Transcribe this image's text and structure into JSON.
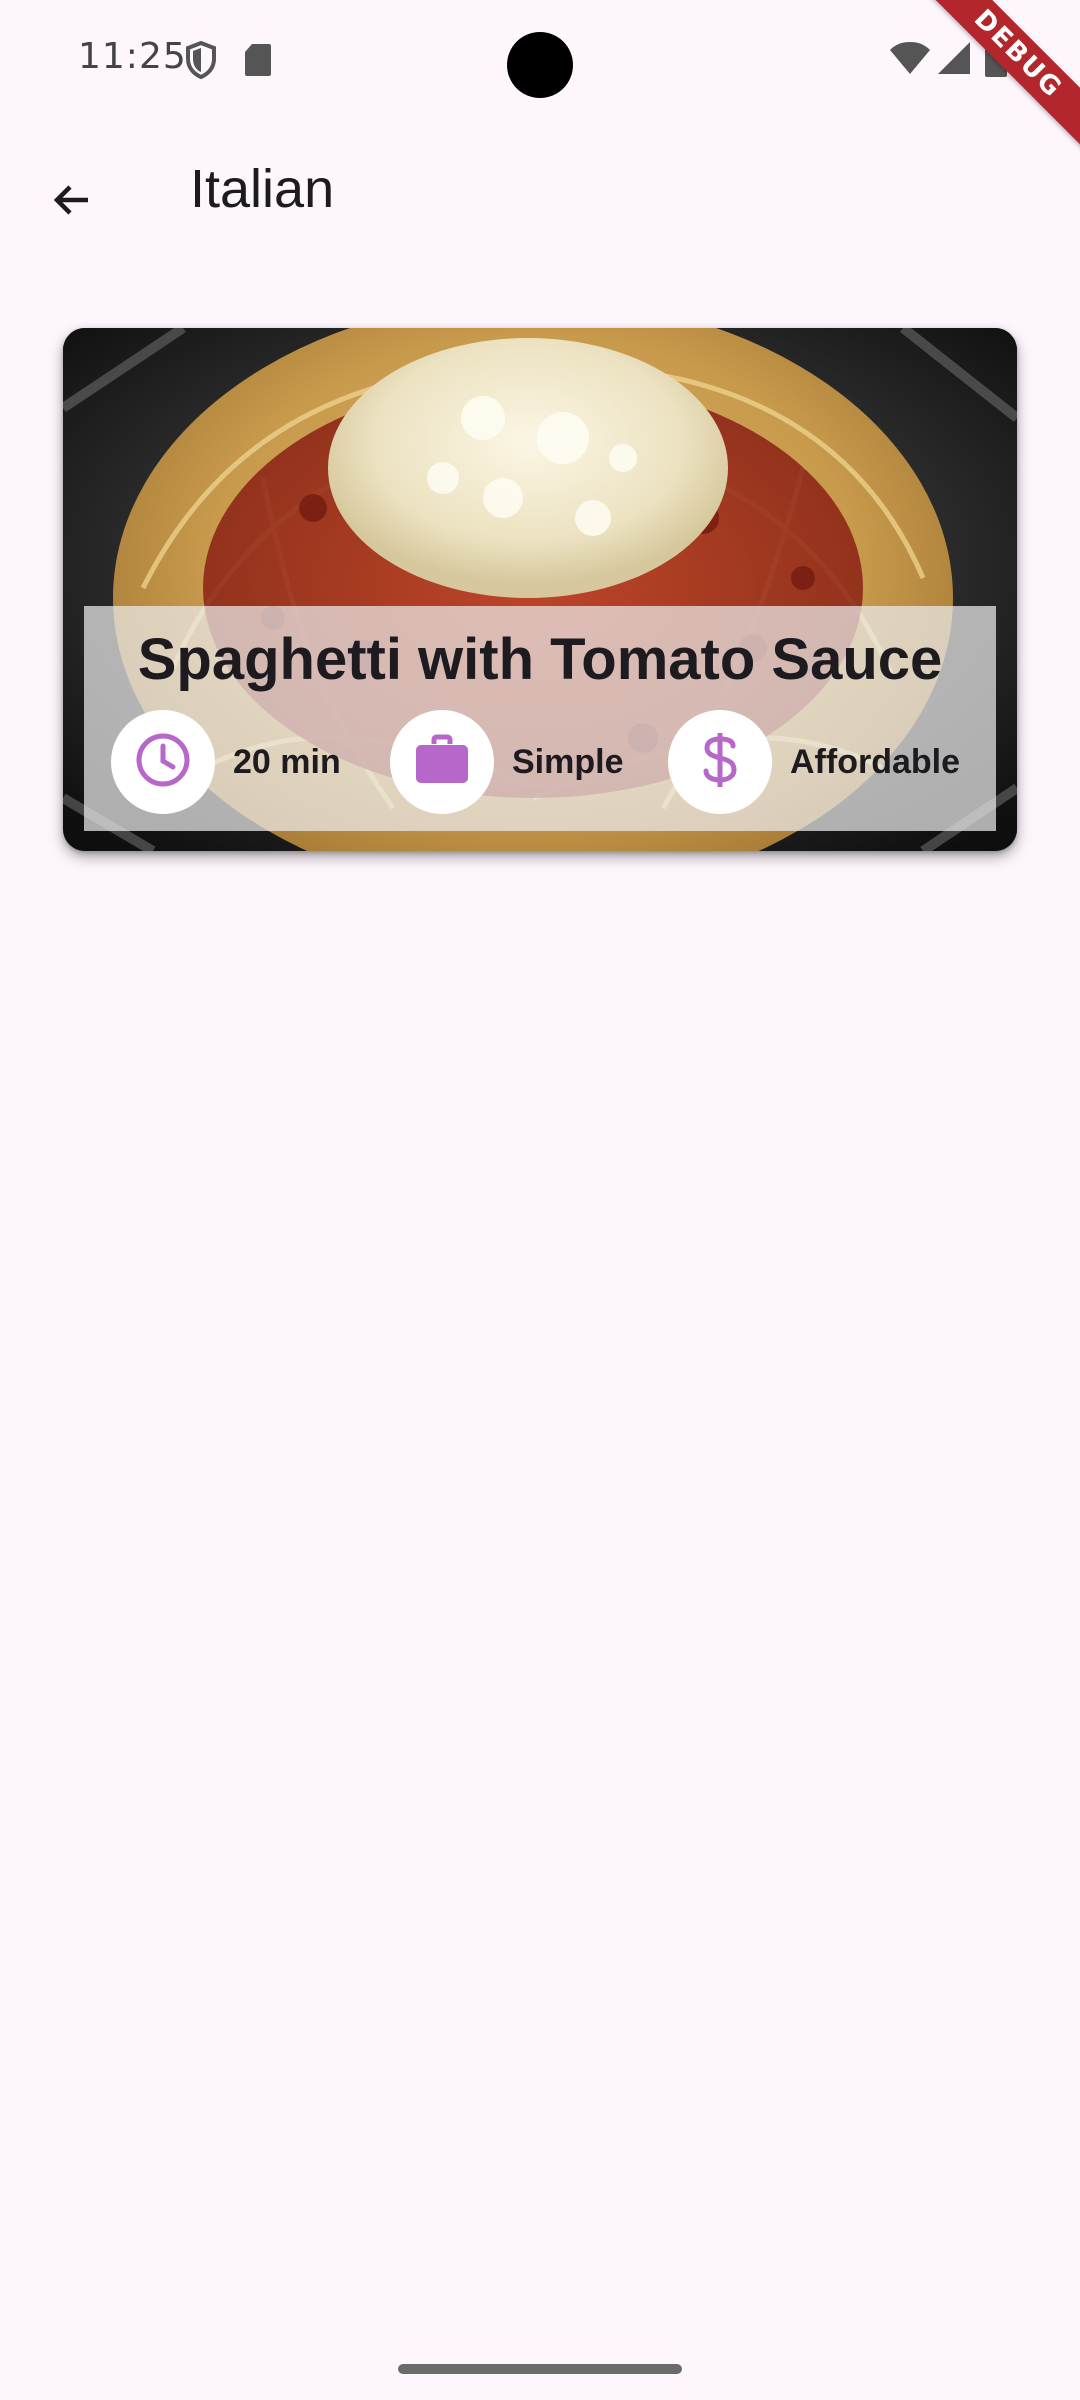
{
  "status_bar": {
    "time": "11:25",
    "icons": [
      "shield-icon",
      "sd-card-icon",
      "wifi-icon",
      "cell-signal-icon",
      "battery-icon"
    ]
  },
  "debug_banner": {
    "label": "DEBUG",
    "color": "#b3262b"
  },
  "app_bar": {
    "back_icon": "arrow-back-icon",
    "title": "Italian"
  },
  "meals": [
    {
      "title": "Spaghetti with Tomato Sauce",
      "traits": [
        {
          "icon": "clock-icon",
          "label": "20 min"
        },
        {
          "icon": "briefcase-icon",
          "label": "Simple"
        },
        {
          "icon": "dollar-icon",
          "label": "Affordable"
        }
      ]
    }
  ],
  "theme": {
    "background": "#fdf7fd",
    "accent": "#b766c9",
    "text": "#1d1b20"
  }
}
